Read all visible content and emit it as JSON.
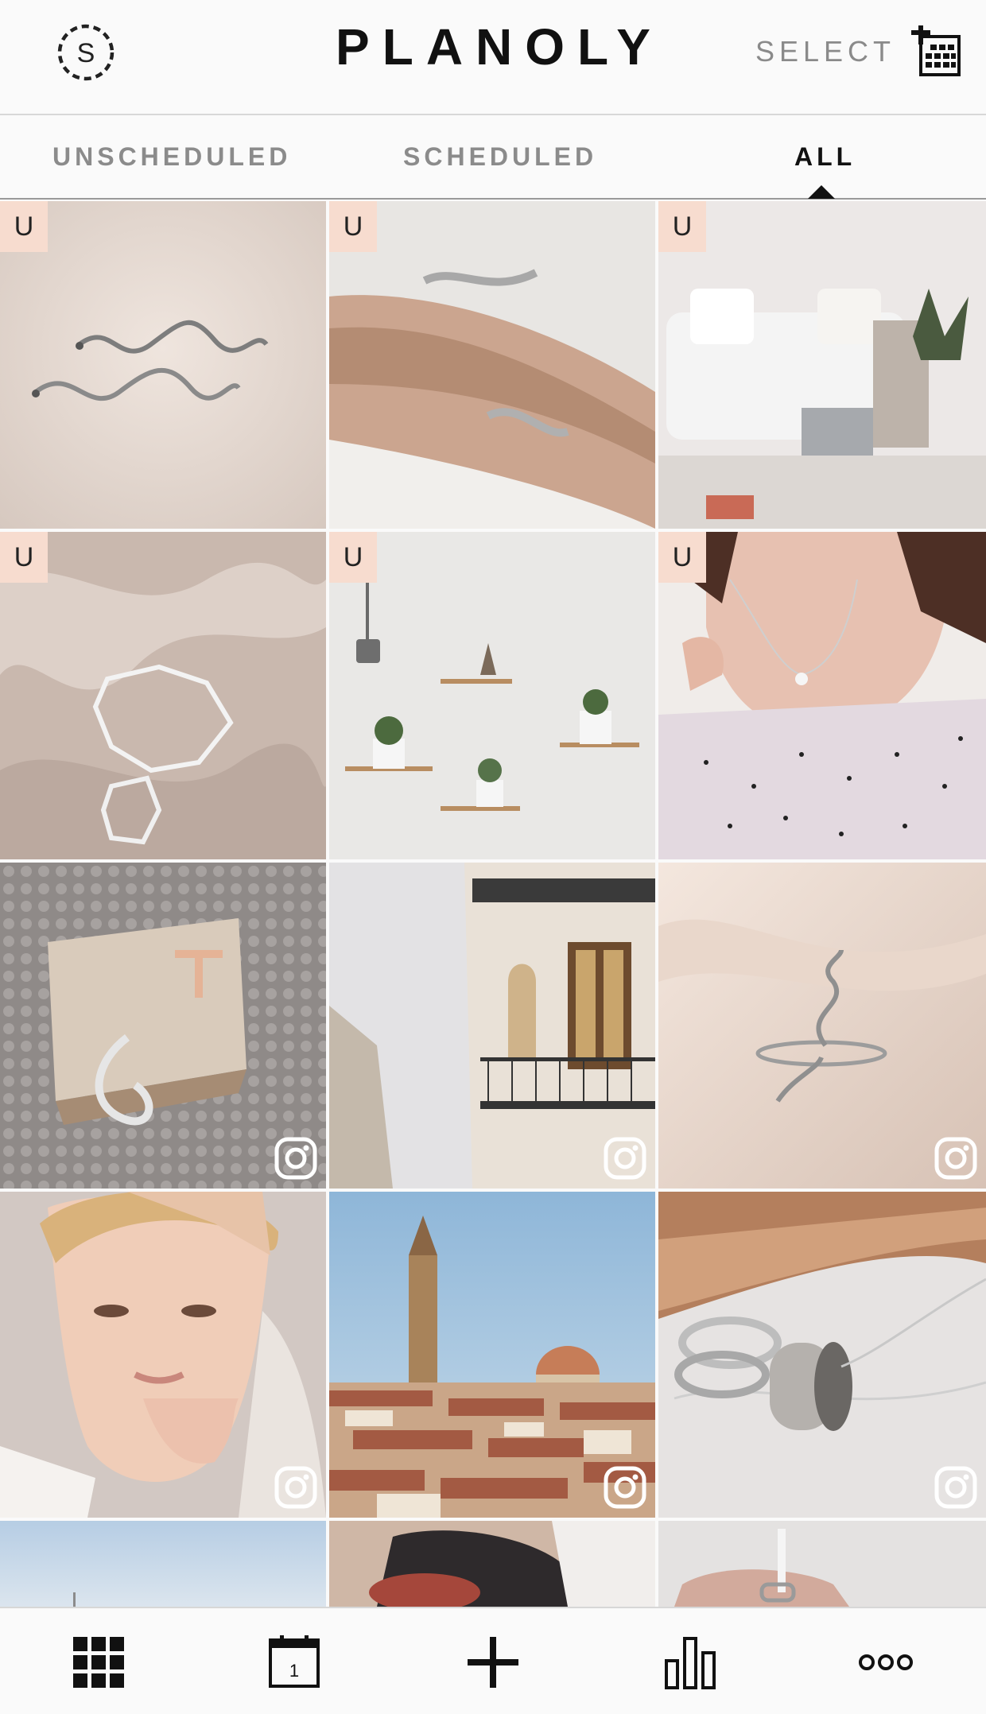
{
  "app": {
    "logo": "PLANOLY",
    "select_label": "SELECT"
  },
  "tabs": [
    {
      "label": "UNSCHEDULED",
      "active": false
    },
    {
      "label": "SCHEDULED",
      "active": false
    },
    {
      "label": "ALL",
      "active": true
    }
  ],
  "grid": {
    "badge_text": "U",
    "tiles": [
      {
        "subject": "snake earrings on sand",
        "badge": "U"
      },
      {
        "subject": "snake cuff bracelet on arm",
        "badge": "U"
      },
      {
        "subject": "white sofa living room",
        "badge": "U"
      },
      {
        "subject": "geometric rings on satin",
        "badge": "U"
      },
      {
        "subject": "wall shelves with plants",
        "badge": "U"
      },
      {
        "subject": "necklace and rings on model",
        "badge": "U"
      },
      {
        "subject": "snake ring on wallet",
        "badge": "instagram"
      },
      {
        "subject": "building with balcony",
        "badge": "instagram"
      },
      {
        "subject": "snake ring on satin",
        "badge": "instagram"
      },
      {
        "subject": "portrait with headscarf",
        "badge": "instagram"
      },
      {
        "subject": "florence rooftops",
        "badge": "instagram"
      },
      {
        "subject": "rings and pendant on marble",
        "badge": "instagram"
      },
      {
        "subject": "sky",
        "badge": "none"
      },
      {
        "subject": "blurred scene",
        "badge": "none"
      },
      {
        "subject": "hand with rings",
        "badge": "none"
      }
    ]
  },
  "bottom_nav": [
    {
      "icon": "grid-icon"
    },
    {
      "icon": "calendar-icon",
      "label": "1"
    },
    {
      "icon": "plus-icon"
    },
    {
      "icon": "analytics-icon"
    },
    {
      "icon": "more-icon"
    }
  ],
  "colors": {
    "unscheduled_badge": "#f7dccf",
    "active_tab": "#111111",
    "inactive_tab": "#8b8b8b"
  }
}
